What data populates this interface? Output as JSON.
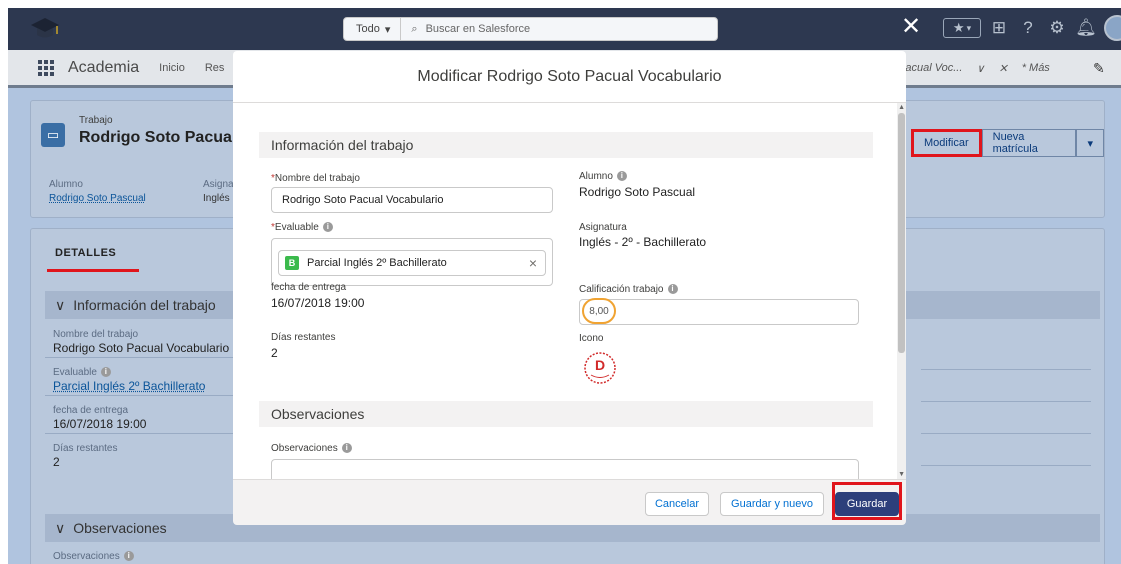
{
  "header": {
    "search_scope": "Todo",
    "search_placeholder": "Buscar en Salesforce"
  },
  "nav": {
    "app_name": "Academia",
    "links": [
      "Inicio",
      "Res"
    ],
    "open_tab": "Pacual Voc...",
    "more": "* Más"
  },
  "record": {
    "type": "Trabajo",
    "title": "Rodrigo Soto Pacual V",
    "fields": [
      {
        "label": "Alumno",
        "value": "Rodrigo Soto Pascual"
      },
      {
        "label": "Asigna",
        "value": "Inglés"
      }
    ],
    "buttons": [
      "Modificar",
      "Nueva matrícula"
    ]
  },
  "details": {
    "tab": "DETALLES",
    "section1": "Información del trabajo",
    "fields": [
      {
        "label": "Nombre del trabajo",
        "value": "Rodrigo Soto Pacual Vocabulario"
      },
      {
        "label": "Evaluable",
        "value": "Parcial Inglés 2º Bachillerato"
      },
      {
        "label": "fecha de entrega",
        "value": "16/07/2018 19:00"
      },
      {
        "label": "Días restantes",
        "value": "2"
      }
    ],
    "section2": "Observaciones",
    "obs_label": "Observaciones"
  },
  "modal": {
    "title": "Modificar Rodrigo Soto Pacual Vocabulario",
    "section1": "Información del trabajo",
    "nombre_label": "Nombre del trabajo",
    "nombre_value": "Rodrigo Soto Pacual Vocabulario",
    "evaluable_label": "Evaluable",
    "evaluable_value": "Parcial Inglés 2º Bachillerato",
    "fecha_label": "fecha de entrega",
    "fecha_value": "16/07/2018 19:00",
    "dias_label": "Días restantes",
    "dias_value": "2",
    "alumno_label": "Alumno",
    "alumno_value": "Rodrigo Soto Pascual",
    "asignatura_label": "Asignatura",
    "asignatura_value": "Inglés - 2º - Bachillerato",
    "calificacion_label": "Calificación trabajo",
    "calificacion_value": "8,00",
    "icono_label": "Icono",
    "section2": "Observaciones",
    "obs_label": "Observaciones",
    "buttons": {
      "cancel": "Cancelar",
      "save_new": "Guardar y nuevo",
      "save": "Guardar"
    }
  },
  "colors": {
    "accent": "#2d3f7b",
    "highlight": "#e0151c",
    "grade_ring": "#f0a332"
  }
}
